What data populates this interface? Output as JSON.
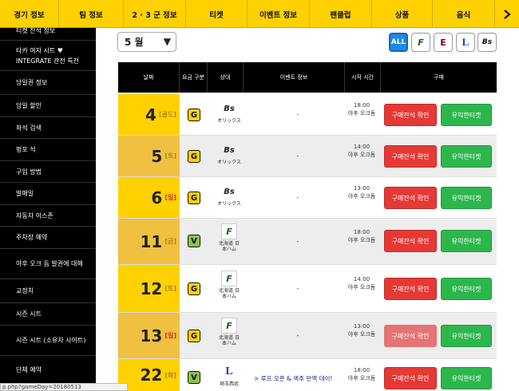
{
  "nav": {
    "items": [
      "경기 정보",
      "팀 정보",
      "2 · 3 군 정보",
      "티켓",
      "이벤트 정보",
      "팬클럽",
      "상품",
      "음식"
    ],
    "next_icon": "chevron-right-icon"
  },
  "sidebar": {
    "items": [
      "티켓 잔석 정보",
      "타카 여자 시트 ♥ INTEGRATE 관전 특전",
      "당일권 정보",
      "당일 할인",
      "좌석 검색",
      "펑포 석",
      "구입 방법",
      "발매일",
      "자동차 이스존",
      "주차장 예약",
      "야후 오크 돔 발권에 대해",
      "교정치",
      "시즌 시트",
      "시즌 시트 (소유자 사이트)",
      "단체 예약"
    ]
  },
  "month": {
    "label": "5 월",
    "caret": "▼"
  },
  "team_filter": {
    "all_label": "ALL",
    "logos": [
      "F",
      "E",
      "L",
      "Bs"
    ],
    "logo_colors": [
      "#1b5e20",
      "#8b0000",
      "#0d47a1",
      "#111111"
    ]
  },
  "table": {
    "headers": [
      "날짜",
      "요금 구분",
      "상대",
      "이벤트 정보",
      "시작 시간",
      "구매"
    ],
    "rows": [
      {
        "day": "4",
        "weekday": "[골드]",
        "grade": "G",
        "logo": "Bs",
        "opp": "オリックス",
        "event": "-",
        "time": "18:00",
        "venue": "야후 오크돔",
        "buy": "구매잔석 확인",
        "paid": "유익한티켓"
      },
      {
        "day": "5",
        "weekday": "[토]",
        "grade": "G",
        "logo": "Bs",
        "opp": "オリックス",
        "event": "-",
        "time": "14:00",
        "venue": "야후 오크돔",
        "buy": "구매잔석 확인",
        "paid": "유익한티켓"
      },
      {
        "day": "6",
        "weekday": "[일]",
        "grade": "G",
        "logo": "Bs",
        "opp": "オリックス",
        "event": "-",
        "time": "13:00",
        "venue": "야후 오크돔",
        "buy": "구매잔석 확인",
        "paid": "유익한티켓"
      },
      {
        "day": "11",
        "weekday": "[금]",
        "grade": "V",
        "logo": "F",
        "opp": "北海道 日本ハム",
        "event": "-",
        "time": "18:00",
        "venue": "야후 오크돔",
        "buy": "구매잔석 확인",
        "paid": "유익한티켓"
      },
      {
        "day": "12",
        "weekday": "[토]",
        "grade": "G",
        "logo": "F",
        "opp": "北海道 日本ハム",
        "event": "-",
        "time": "14:00",
        "venue": "야후 오크돔",
        "buy": "구매잔석 확인",
        "paid": "유익한티켓"
      },
      {
        "day": "13",
        "weekday": "[일]",
        "grade": "G",
        "logo": "F",
        "opp": "北海道 日本ハム",
        "event": "-",
        "time": "13:00",
        "venue": "야후 오크돔",
        "buy": "구매잔석 확인",
        "paid": "유익한티켓"
      },
      {
        "day": "22",
        "weekday": "[화]",
        "grade": "V",
        "logo": "L",
        "opp": "埼玉西武",
        "event": "> 루프 오픈 & 맥주 반액 데이!",
        "time": "18:00",
        "venue": "야후 오크돔",
        "buy": "구매잔석 확인",
        "paid": "유익한티켓"
      }
    ]
  },
  "status": "p.php?gameDay=20180513",
  "colors": {
    "accent": "#ffd100",
    "buy": "#e53935",
    "paid": "#2db64c",
    "all": "#1e88e5"
  }
}
